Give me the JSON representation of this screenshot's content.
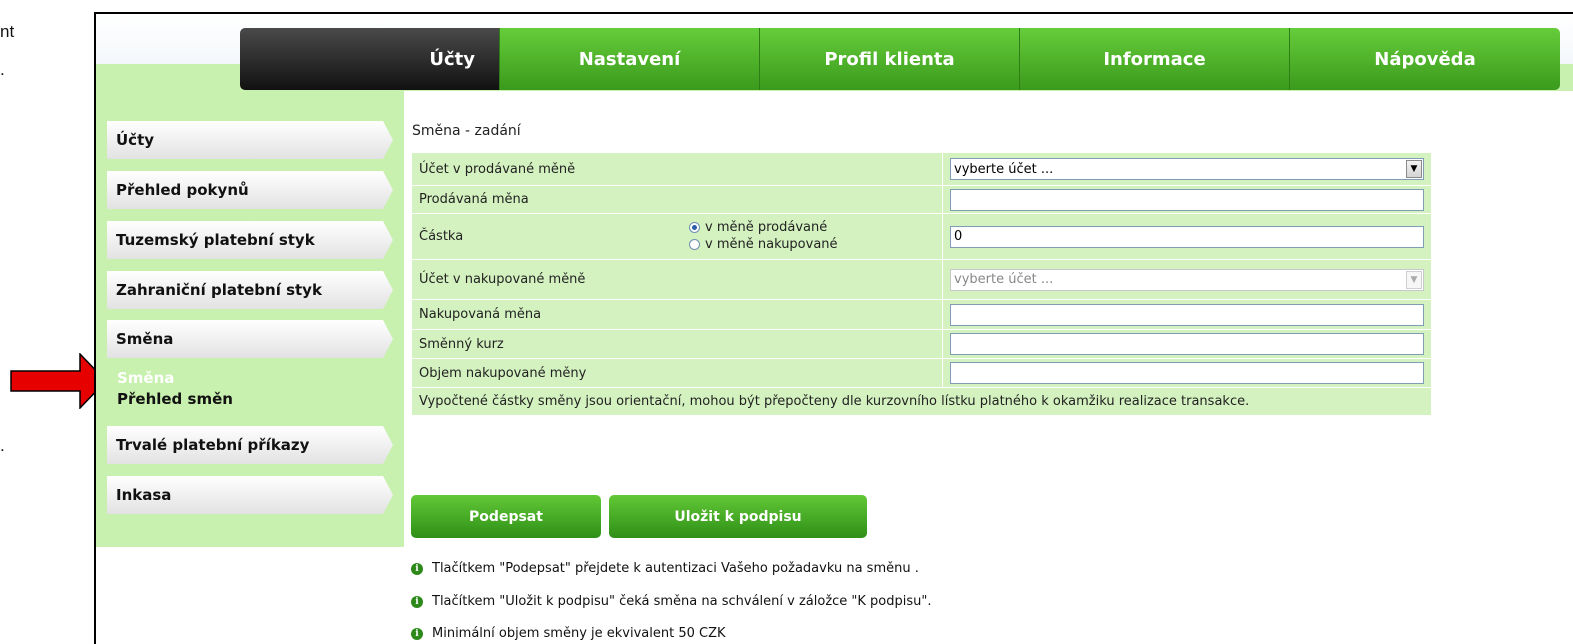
{
  "left_fragments": {
    "top1": "nt",
    "top2": ".",
    "bottom": "."
  },
  "menu": {
    "tabs": [
      {
        "label": "Účty",
        "active": true
      },
      {
        "label": "Nastavení",
        "active": false
      },
      {
        "label": "Profil klienta",
        "active": false
      },
      {
        "label": "Informace",
        "active": false
      },
      {
        "label": "Nápověda",
        "active": false
      }
    ]
  },
  "sidebar": {
    "items": [
      {
        "label": "Účty"
      },
      {
        "label": "Přehled pokynů"
      },
      {
        "label": "Tuzemský platební styk"
      },
      {
        "label": "Zahraniční platební styk"
      },
      {
        "label": "Směna"
      },
      {
        "label": "Trvalé platební příkazy"
      },
      {
        "label": "Inkasa"
      }
    ],
    "subitems": [
      {
        "label": "Směna",
        "active": true
      },
      {
        "label": "Přehled směn",
        "active": false
      }
    ]
  },
  "form": {
    "title": "Směna - zadání",
    "rows": {
      "sell_account": {
        "label": "Účet v prodávané měně",
        "value": "vyberte účet ..."
      },
      "sell_currency": {
        "label": "Prodávaná měna",
        "value": ""
      },
      "amount": {
        "label": "Částka",
        "value": "0",
        "radio_sell": "v měně prodávané",
        "radio_buy": "v měně nakupované"
      },
      "buy_account": {
        "label": "Účet v nakupované měně",
        "value": "vyberte účet ..."
      },
      "buy_currency": {
        "label": "Nakupovaná měna",
        "value": ""
      },
      "rate": {
        "label": "Směnný kurz",
        "value": ""
      },
      "buy_volume": {
        "label": "Objem nakupované měny",
        "value": ""
      }
    },
    "note": "Vypočtené částky směny jsou orientační, mohou být přepočteny dle kurzovního lístku platného k okamžiku realizace transakce."
  },
  "buttons": {
    "sign": "Podepsat",
    "save": "Uložit k podpisu"
  },
  "info": [
    "Tlačítkem \"Podepsat\" přejdete k autentizaci Vašeho požadavku na směnu .",
    "Tlačítkem \"Uložit k podpisu\" čeká směna na schválení v záložce \"K podpisu\".",
    "Minimální objem směny je ekvivalent 50 CZK"
  ],
  "colors": {
    "menu_green": "#4cb52a",
    "sidebar_green": "#c8f0ae",
    "row_green": "#d4f2c0",
    "arrow_red": "#e60000"
  }
}
